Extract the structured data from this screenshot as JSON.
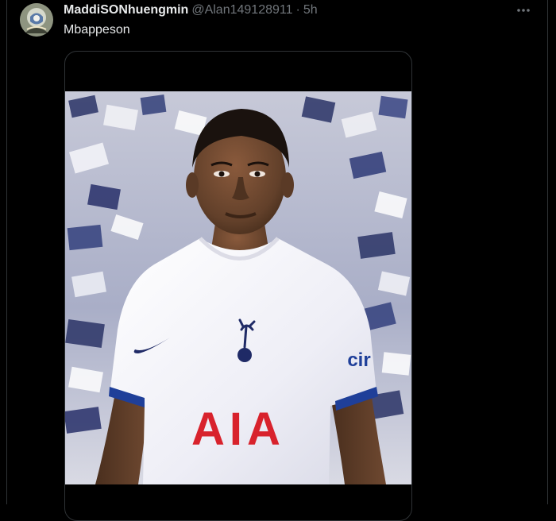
{
  "post": {
    "author_name": "MaddiSONhuengmin",
    "author_handle": "@Alan149128911",
    "separator": "·",
    "timestamp": "5h",
    "text": "Mbappeson",
    "more_icon": "more-horizontal-icon"
  },
  "media": {
    "jersey_sponsor": "AIA",
    "sleeve_sponsor": "cir",
    "colors": {
      "background": "#000000",
      "jersey": "#f3f2f8",
      "sponsor_red": "#d8222c",
      "sleeve_trim": "#1f3f99",
      "crowd_navy": "#2b3467"
    }
  }
}
